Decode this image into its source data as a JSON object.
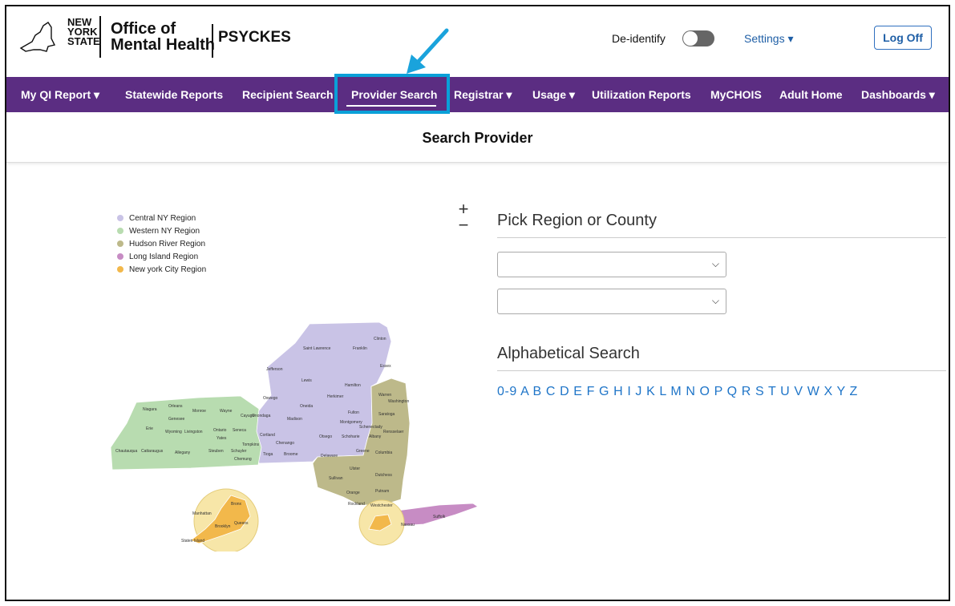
{
  "header": {
    "state_logo": [
      "NEW",
      "YORK",
      "STATE"
    ],
    "office_line1": "Office of",
    "office_line2": "Mental Health",
    "app_name": "PSYCKES",
    "deidentify_label": "De-identify",
    "settings_label": "Settings ▾",
    "logoff_label": "Log Off"
  },
  "nav": {
    "items": [
      {
        "label": "My QI Report ▾"
      },
      {
        "label": "Statewide Reports"
      },
      {
        "label": "Recipient Search"
      },
      {
        "label": "Provider Search"
      },
      {
        "label": "Registrar ▾"
      },
      {
        "label": "Usage ▾"
      },
      {
        "label": "Utilization Reports"
      },
      {
        "label": "MyCHOIS"
      },
      {
        "label": "Adult Home"
      },
      {
        "label": "Dashboards ▾"
      }
    ],
    "active": "Provider Search"
  },
  "page": {
    "title": "Search Provider"
  },
  "legend": {
    "items": [
      {
        "label": "Central NY Region",
        "color": "#c9c3e6"
      },
      {
        "label": "Western NY Region",
        "color": "#b8dcb0"
      },
      {
        "label": "Hudson River Region",
        "color": "#bdb98a"
      },
      {
        "label": "Long Island Region",
        "color": "#c78cc4"
      },
      {
        "label": "New york City Region",
        "color": "#f2b84b"
      }
    ]
  },
  "zoom": {
    "in": "+",
    "out": "−"
  },
  "map_labels": {
    "central": [
      "Clinton",
      "Franklin",
      "Saint Lawrence",
      "Essex",
      "Jefferson",
      "Lewis",
      "Hamilton",
      "Oswego",
      "Herkimer",
      "Oneida",
      "Fulton",
      "Cayuga",
      "Onondaga",
      "Madison",
      "Montgomery",
      "Cortland",
      "Otsego",
      "Tompkins",
      "Chenango",
      "Tioga",
      "Broome",
      "Delaware",
      "Chemung",
      "Schuyler"
    ],
    "western": [
      "Niagara",
      "Orleans",
      "Monroe",
      "Wayne",
      "Genesee",
      "Erie",
      "Wyoming",
      "Livingston",
      "Ontario",
      "Seneca",
      "Yates",
      "Chautauqua",
      "Cattaraugus",
      "Allegany",
      "Steuben"
    ],
    "hudson": [
      "Warren",
      "Washington",
      "Saratoga",
      "Schenectady",
      "Rensselaer",
      "Schoharie",
      "Albany",
      "Greene",
      "Columbia",
      "Ulster",
      "Dutchess",
      "Sullivan",
      "Orange",
      "Putnam",
      "Rockland",
      "Westchester"
    ],
    "long_island": [
      "Nassau",
      "Suffolk"
    ],
    "nyc": [
      "Bronx",
      "Manhattan",
      "Queens",
      "Brooklyn",
      "Staten Island"
    ]
  },
  "right": {
    "pick_title": "Pick Region or County",
    "region_select_value": "",
    "county_select_value": "",
    "alpha_title": "Alphabetical Search",
    "letters": [
      "0-9",
      "A",
      "B",
      "C",
      "D",
      "E",
      "F",
      "G",
      "H",
      "I",
      "J",
      "K",
      "L",
      "M",
      "N",
      "O",
      "P",
      "Q",
      "R",
      "S",
      "T",
      "U",
      "V",
      "W",
      "X",
      "Y",
      "Z"
    ]
  },
  "colors": {
    "nav_bg": "#5b2d82",
    "highlight": "#0aa0d8",
    "link": "#1f75c8"
  }
}
